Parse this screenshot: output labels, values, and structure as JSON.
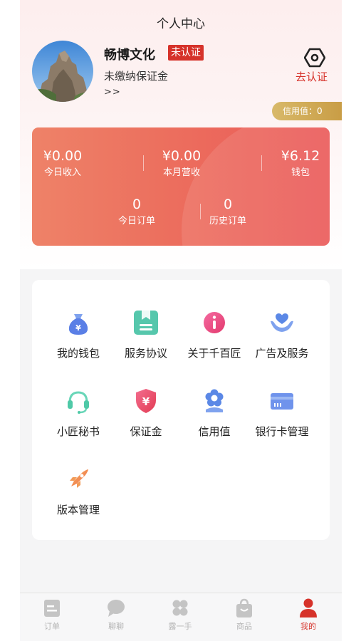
{
  "page_title": "个人中心",
  "user": {
    "name": "畅博文化",
    "cert_status": "未认证",
    "deposit_status": "未缴纳保证金",
    "more": ">>"
  },
  "verify": {
    "label": "去认证",
    "icon": "hexagon-eye-icon"
  },
  "credit_tag": "信用值：0",
  "stats": {
    "today_income": {
      "value": "¥0.00",
      "label": "今日收入"
    },
    "month_revenue": {
      "value": "¥0.00",
      "label": "本月营收"
    },
    "wallet": {
      "value": "¥6.12",
      "label": "钱包"
    },
    "today_orders": {
      "value": "0",
      "label": "今日订单"
    },
    "history_orders": {
      "value": "0",
      "label": "历史订单"
    }
  },
  "menu": [
    {
      "label": "我的钱包",
      "icon": "money-bag-icon"
    },
    {
      "label": "服务协议",
      "icon": "document-icon"
    },
    {
      "label": "关于千百匠",
      "icon": "info-icon"
    },
    {
      "label": "广告及服务",
      "icon": "heart-hands-icon"
    },
    {
      "label": "小匠秘书",
      "icon": "headset-icon"
    },
    {
      "label": "保证金",
      "icon": "shield-yen-icon"
    },
    {
      "label": "信用值",
      "icon": "flower-badge-icon"
    },
    {
      "label": "银行卡管理",
      "icon": "bank-card-icon"
    },
    {
      "label": "版本管理",
      "icon": "rocket-icon"
    }
  ],
  "tabbar": [
    {
      "label": "订单",
      "icon": "order-icon",
      "active": false
    },
    {
      "label": "聊聊",
      "icon": "chat-icon",
      "active": false
    },
    {
      "label": "露一手",
      "icon": "showcase-icon",
      "active": false
    },
    {
      "label": "商品",
      "icon": "shopping-bag-icon",
      "active": false
    },
    {
      "label": "我的",
      "icon": "profile-icon",
      "active": true
    }
  ],
  "colors": {
    "accent": "#d6322a",
    "card_gradient_start": "#ee8268",
    "card_gradient_end": "#ea5857",
    "credit_gold": "#c99d45"
  }
}
